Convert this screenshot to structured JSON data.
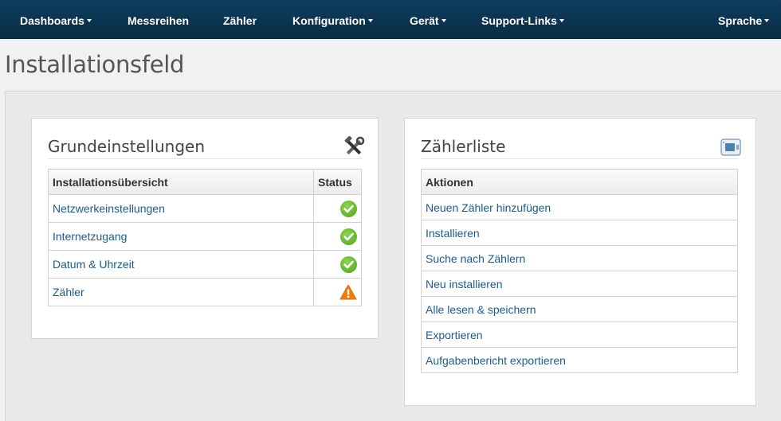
{
  "nav": {
    "dashboards": "Dashboards",
    "messreihen": "Messreihen",
    "zaehler": "Zähler",
    "konfiguration": "Konfiguration",
    "geraet": "Gerät",
    "support": "Support-Links",
    "sprache": "Sprache"
  },
  "page": {
    "title": "Installationsfeld"
  },
  "grundeinstellungen": {
    "title": "Grundeinstellungen",
    "icon": "tools-icon",
    "col_overview": "Installationsübersicht",
    "col_status": "Status",
    "rows": [
      {
        "label": "Netzwerkeinstellungen",
        "status": "ok"
      },
      {
        "label": "Internetzugang",
        "status": "ok"
      },
      {
        "label": "Datum & Uhrzeit",
        "status": "ok"
      },
      {
        "label": "Zähler",
        "status": "warning"
      }
    ]
  },
  "zaehlerliste": {
    "title": "Zählerliste",
    "icon": "meter-icon",
    "col_actions": "Aktionen",
    "actions": [
      "Neuen Zähler hinzufügen",
      "Installieren",
      "Suche nach Zählern",
      "Neu installieren",
      "Alle lesen & speichern",
      "Exportieren",
      "Aufgabenbericht exportieren"
    ]
  },
  "colors": {
    "navbar": "#0f3e5f",
    "link": "#1d5b8a",
    "ok": "#5cb523",
    "warning": "#f07d10"
  }
}
